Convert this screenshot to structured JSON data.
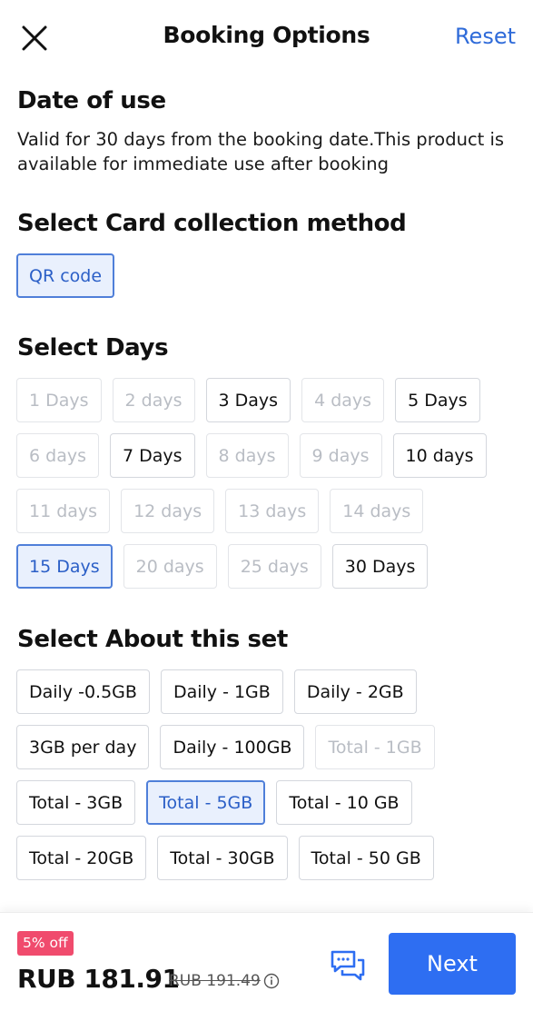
{
  "header": {
    "close_icon": "close-icon",
    "title": "Booking Options",
    "reset": "Reset"
  },
  "date_of_use": {
    "title": "Date of use",
    "description": "Valid for 30 days from the booking date.This product is available for immediate use after booking"
  },
  "collection": {
    "title": "Select Card collection method",
    "options": [
      {
        "label": "QR code",
        "state": "selected"
      }
    ]
  },
  "days": {
    "title": "Select Days",
    "options": [
      {
        "label": "1 Days",
        "state": "disabled"
      },
      {
        "label": "2 days",
        "state": "disabled"
      },
      {
        "label": "3 Days",
        "state": "available"
      },
      {
        "label": "4 days",
        "state": "disabled"
      },
      {
        "label": "5 Days",
        "state": "available"
      },
      {
        "label": "6 days",
        "state": "disabled"
      },
      {
        "label": "7 Days",
        "state": "available"
      },
      {
        "label": "8 days",
        "state": "disabled"
      },
      {
        "label": "9 days",
        "state": "disabled"
      },
      {
        "label": "10 days",
        "state": "available"
      },
      {
        "label": "11 days",
        "state": "disabled"
      },
      {
        "label": "12 days",
        "state": "disabled"
      },
      {
        "label": "13 days",
        "state": "disabled"
      },
      {
        "label": "14 days",
        "state": "disabled"
      },
      {
        "label": "15 Days",
        "state": "selected"
      },
      {
        "label": "20 days",
        "state": "disabled"
      },
      {
        "label": "25 days",
        "state": "disabled"
      },
      {
        "label": "30 Days",
        "state": "available"
      }
    ]
  },
  "set": {
    "title": "Select About this set",
    "options": [
      {
        "label": "Daily -0.5GB",
        "state": "available"
      },
      {
        "label": "Daily - 1GB",
        "state": "available"
      },
      {
        "label": "Daily - 2GB",
        "state": "available"
      },
      {
        "label": "3GB per day",
        "state": "available"
      },
      {
        "label": "Daily - 100GB",
        "state": "available"
      },
      {
        "label": "Total - 1GB",
        "state": "disabled"
      },
      {
        "label": "Total - 3GB",
        "state": "available"
      },
      {
        "label": "Total - 5GB",
        "state": "selected"
      },
      {
        "label": "Total - 10 GB",
        "state": "available"
      },
      {
        "label": "Total - 20GB",
        "state": "available"
      },
      {
        "label": "Total - 30GB",
        "state": "available"
      },
      {
        "label": "Total - 50 GB",
        "state": "available"
      }
    ]
  },
  "footer": {
    "discount": "5% off",
    "price": "RUB 181.91",
    "original_price": "RUB 191.49",
    "info_icon": "info-icon",
    "chat_icon": "chat-icon",
    "next": "Next"
  },
  "colors": {
    "accent": "#2e6ef2",
    "selected_border": "#4f7fd9",
    "selected_bg": "#e9f0fd",
    "badge": "#f04b6d"
  }
}
